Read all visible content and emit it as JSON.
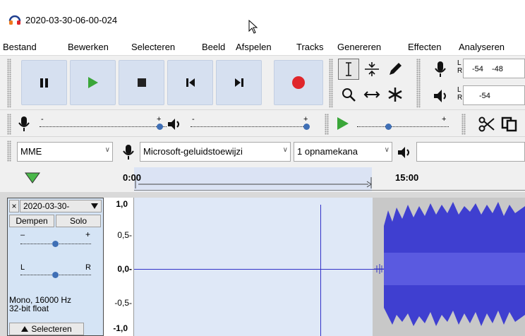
{
  "window": {
    "title": "2020-03-30-06-00-024"
  },
  "menu": [
    "Bestand",
    "Bewerken",
    "Selecteren",
    "Beeld",
    "Afspelen",
    "Tracks",
    "Genereren",
    "Effecten",
    "Analyseren"
  ],
  "transport": {
    "buttons": [
      "pause",
      "play",
      "stop",
      "skip-start",
      "skip-end",
      "record"
    ]
  },
  "meters": {
    "record": {
      "l": "L",
      "r": "R",
      "db1": "-54",
      "db2": "-48"
    },
    "play": {
      "l": "L",
      "r": "R",
      "db1": "-54"
    }
  },
  "devices": {
    "host": "MME",
    "input": "Microsoft-geluidstoewijzi",
    "channels": "1 opnamekana"
  },
  "timeline": {
    "ticks": [
      "0:00",
      "15:00"
    ]
  },
  "track": {
    "name": "2020-03-30-",
    "mute": "Dempen",
    "solo": "Solo",
    "gain_minus": "–",
    "gain_plus": "+",
    "pan_l": "L",
    "pan_r": "R",
    "info_line1": "Mono, 16000 Hz",
    "info_line2": "32-bit float",
    "select": "Selecteren",
    "close": "×",
    "scale": [
      "1,0",
      "0,5-",
      "0,0-",
      "-0,5-",
      "-1,0"
    ]
  },
  "colors": {
    "record": "#e0262b",
    "play": "#3aa639",
    "knob": "#3f6fb5",
    "waveform": "#3232c8",
    "selection": "#dfe8f7"
  }
}
